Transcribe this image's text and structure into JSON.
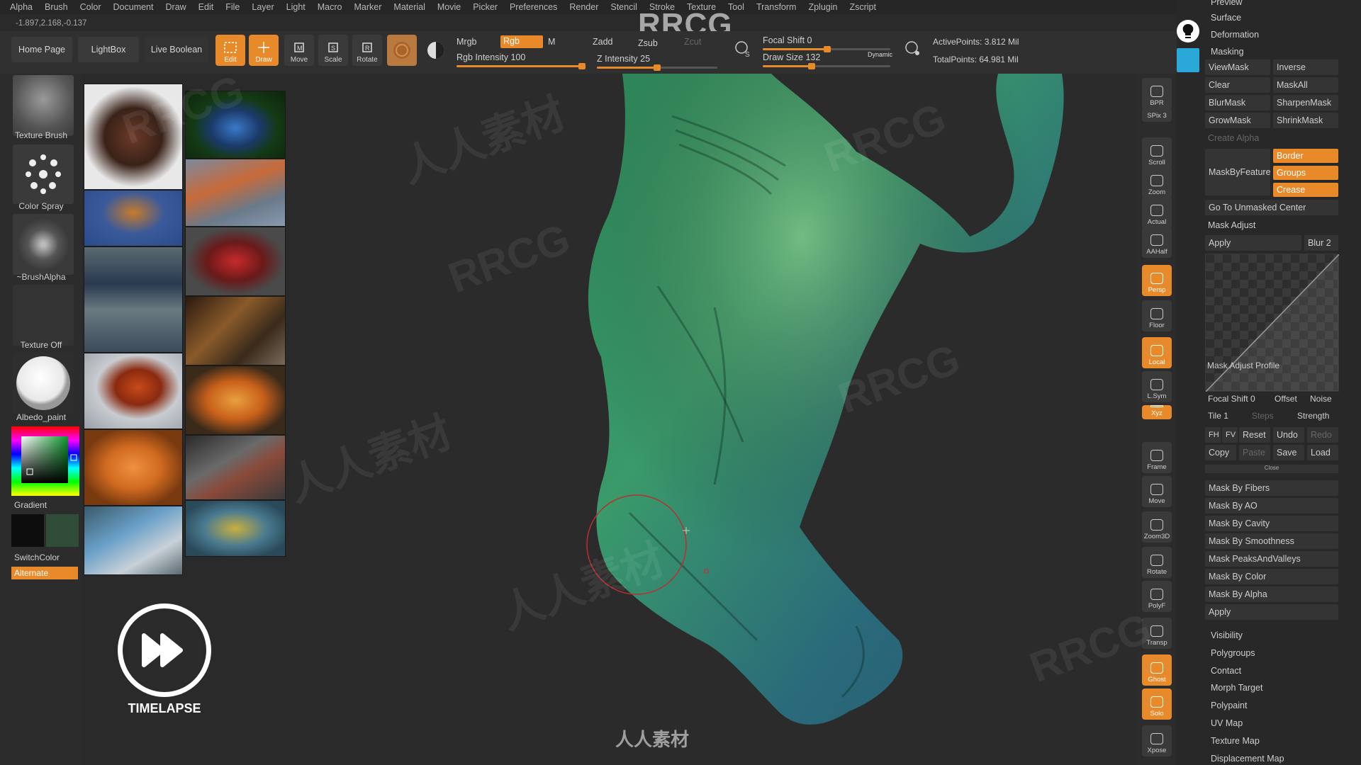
{
  "menu": [
    "Alpha",
    "Brush",
    "Color",
    "Document",
    "Draw",
    "Edit",
    "File",
    "Layer",
    "Light",
    "Macro",
    "Marker",
    "Material",
    "Movie",
    "Picker",
    "Preferences",
    "Render",
    "Stencil",
    "Stroke",
    "Texture",
    "Tool",
    "Transform",
    "Zplugin",
    "Zscript"
  ],
  "coords": "-1.897,2.168,-0.137",
  "logo": "RRCG",
  "topbar": {
    "home": "Home Page",
    "lightbox": "LightBox",
    "live_boolean": "Live Boolean",
    "edit": "Edit",
    "draw": "Draw",
    "move": "Move",
    "scale": "Scale",
    "rotate": "Rotate",
    "mrgb": "Mrgb",
    "rgb": "Rgb",
    "m": "M",
    "rgb_intensity_label": "Rgb Intensity",
    "rgb_intensity": 100,
    "zadd": "Zadd",
    "zsub": "Zsub",
    "zcut": "Zcut",
    "z_intensity_label": "Z Intensity",
    "z_intensity": 25,
    "focal_shift_label": "Focal Shift",
    "focal_shift": 0,
    "draw_size_label": "Draw Size",
    "draw_size": 132,
    "dynamic": "Dynamic",
    "active_points": "ActivePoints: 3.812 Mil",
    "total_points": "TotalPoints: 64.981 Mil"
  },
  "left": {
    "texture_brush": "Texture Brush",
    "color_spray": "Color Spray",
    "brush_alpha": "~BrushAlpha",
    "texture_off": "Texture Off",
    "material": "Albedo_paint",
    "gradient": "Gradient",
    "switch_color": "SwitchColor",
    "alternate": "Alternate",
    "colors": {
      "primary": "#0d0d0d",
      "secondary": "#2f4d39",
      "accent": "#e8892a"
    }
  },
  "timelapse": "TIMELAPSE",
  "righttools": [
    {
      "label": "BPR",
      "icon": "sphere-icon",
      "on": false
    },
    {
      "label": "SPix 3",
      "icon": "",
      "on": false
    },
    {
      "label": "Scroll",
      "icon": "hand-icon",
      "on": false
    },
    {
      "label": "Zoom",
      "icon": "magnifier-icon",
      "on": false
    },
    {
      "label": "Actual",
      "icon": "magnifier-icon",
      "on": false
    },
    {
      "label": "AAHalf",
      "icon": "magnifier-icon",
      "on": false
    },
    {
      "label": "Persp",
      "icon": "grid-icon",
      "on": true
    },
    {
      "label": "Floor",
      "icon": "floor-icon",
      "on": false
    },
    {
      "label": "Local",
      "icon": "local-icon",
      "on": true
    },
    {
      "label": "L.Sym",
      "icon": "sym-icon",
      "on": false
    },
    {
      "label": "Xyz",
      "icon": "xyz-icon",
      "on": true
    },
    {
      "label": "Frame",
      "icon": "frame-icon",
      "on": false
    },
    {
      "label": "Move",
      "icon": "hand-icon",
      "on": false
    },
    {
      "label": "Zoom3D",
      "icon": "magnifier-icon",
      "on": false
    },
    {
      "label": "Rotate",
      "icon": "rotate-icon",
      "on": false
    },
    {
      "label": "PolyF",
      "icon": "grid-icon",
      "on": false
    },
    {
      "label": "Transp",
      "icon": "transp-icon",
      "on": false
    },
    {
      "label": "Ghost",
      "icon": "ghost-icon",
      "on": true
    },
    {
      "label": "Solo",
      "icon": "solo-icon",
      "on": true
    },
    {
      "label": "Xpose",
      "icon": "xpose-icon",
      "on": false
    }
  ],
  "rpanel": {
    "preview": "Preview",
    "surface": "Surface",
    "deformation": "Deformation",
    "masking": "Masking",
    "viewmask": "ViewMask",
    "inverse": "Inverse",
    "clear": "Clear",
    "maskall": "MaskAll",
    "blurmask": "BlurMask",
    "sharpenmask": "SharpenMask",
    "growmask": "GrowMask",
    "shrinkmask": "ShrinkMask",
    "create_alpha": "Create Alpha",
    "maskbyfeature": "MaskByFeature",
    "border": "Border",
    "groups": "Groups",
    "crease": "Crease",
    "goto_unmasked": "Go To Unmasked Center",
    "mask_adjust": "Mask Adjust",
    "apply": "Apply",
    "blur": "Blur 2",
    "profile": "Mask Adjust Profile",
    "focal_shift": "Focal Shift 0",
    "offset": "Offset",
    "noise": "Noise",
    "tile": "Tile 1",
    "steps": "Steps",
    "strength": "Strength",
    "fh": "FH",
    "fv": "FV",
    "reset": "Reset",
    "undo": "Undo",
    "redo": "Redo",
    "copy": "Copy",
    "paste": "Paste",
    "save": "Save",
    "load": "Load",
    "close": "Close",
    "mask_by": [
      "Mask By Fibers",
      "Mask By AO",
      "Mask By Cavity",
      "Mask By Smoothness",
      "Mask PeaksAndValleys",
      "Mask By Color",
      "Mask By Alpha",
      "Apply"
    ],
    "sections": [
      "Visibility",
      "Polygroups",
      "Contact",
      "Morph Target",
      "Polypaint",
      "UV Map",
      "Texture Map",
      "Displacement Map"
    ]
  },
  "watermarks": [
    "RRCG",
    "人人素材"
  ],
  "bottom_logo": "人人素材"
}
